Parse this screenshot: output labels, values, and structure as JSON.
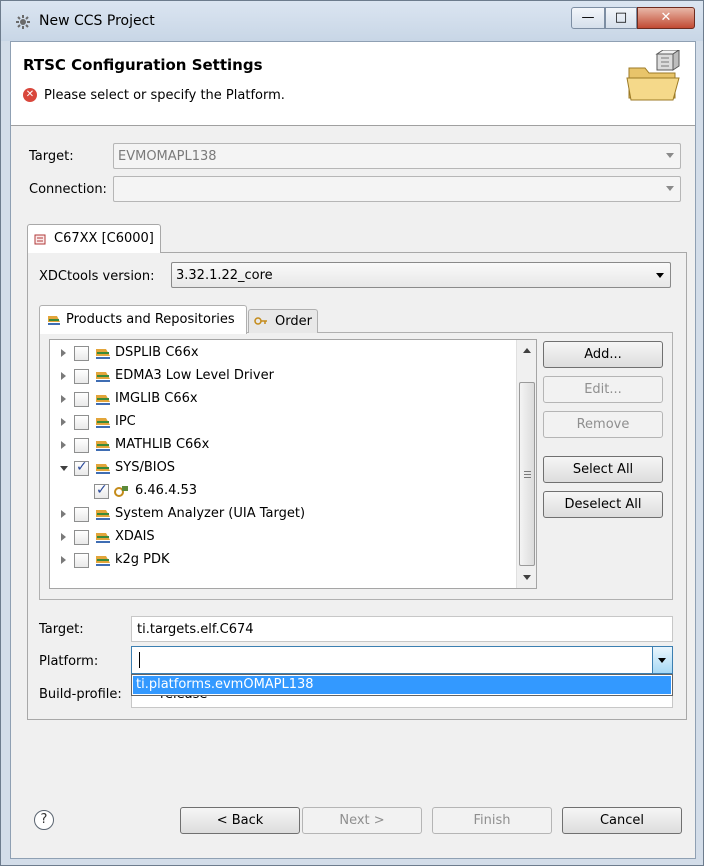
{
  "window": {
    "title": "New CCS Project",
    "buttons": {
      "minimize": "—",
      "maximize": "□",
      "close": "✕"
    }
  },
  "header": {
    "title": "RTSC Configuration Settings",
    "message": "Please select or specify the Platform.",
    "error_icon": "error-icon",
    "banner_icon": "folder-package-icon"
  },
  "device": {
    "target_label": "Target:",
    "target_value": "EVMOMAPL138",
    "connection_label": "Connection:",
    "connection_value": ""
  },
  "outer_tab": {
    "label": "C67XX [C6000]"
  },
  "xdctools": {
    "label": "XDCtools version:",
    "value": "3.32.1.22_core"
  },
  "inner_tabs": [
    {
      "label": "Products and Repositories",
      "active": true
    },
    {
      "label": "Order",
      "active": false
    }
  ],
  "products": [
    {
      "label": "DSPLIB C66x",
      "checked": false,
      "expanded": false
    },
    {
      "label": "EDMA3 Low Level Driver",
      "checked": false,
      "expanded": false
    },
    {
      "label": "IMGLIB C66x",
      "checked": false,
      "expanded": false
    },
    {
      "label": "IPC",
      "checked": false,
      "expanded": false
    },
    {
      "label": "MATHLIB C66x",
      "checked": false,
      "expanded": false
    },
    {
      "label": "SYS/BIOS",
      "checked": true,
      "expanded": true
    },
    {
      "label": "6.46.4.53",
      "checked": true,
      "child": true
    },
    {
      "label": "System Analyzer (UIA Target)",
      "checked": false,
      "expanded": false
    },
    {
      "label": "XDAIS",
      "checked": false,
      "expanded": false
    },
    {
      "label": "k2g PDK",
      "checked": false,
      "expanded": false
    }
  ],
  "side_buttons": {
    "add": "Add...",
    "edit": "Edit...",
    "remove": "Remove",
    "select_all": "Select All",
    "deselect_all": "Deselect All"
  },
  "build": {
    "target_label": "Target:",
    "target_value": "ti.targets.elf.C674",
    "platform_label": "Platform:",
    "platform_value": "",
    "platform_option": "ti.platforms.evmOMAPL138",
    "profile_label": "Build-profile:",
    "profile_value": "release"
  },
  "footer": {
    "help": "?",
    "back": "< Back",
    "next": "Next >",
    "finish": "Finish",
    "cancel": "Cancel"
  }
}
